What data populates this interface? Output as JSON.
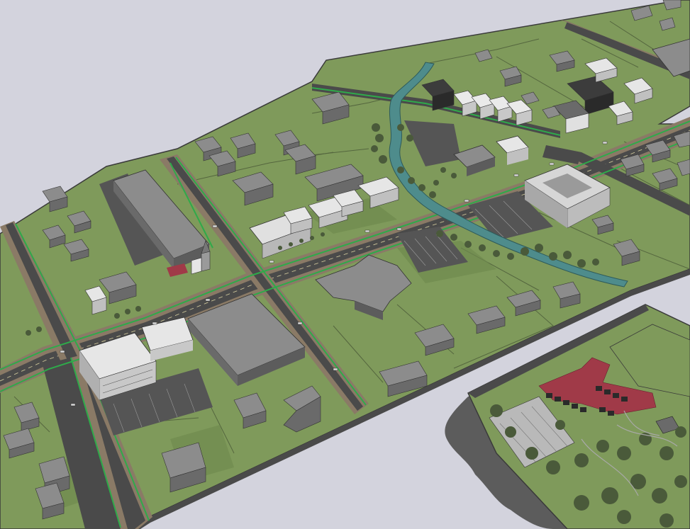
{
  "scene": {
    "kind": "3d-urban-model",
    "colors": {
      "sky": "#d3d3dd",
      "grass": "#7f9a5b",
      "grass_dark": "#6f8a4e",
      "road": "#4a4a4a",
      "sidewalk": "#8a7a66",
      "parking": "#555555",
      "building_gray": "#8c8c8c",
      "building_white": "#e6e6e6",
      "building_dark": "#3c3c3c",
      "roof_dark": "#6a6a6a",
      "water": "#4e8c8c",
      "bike_lane": "#2faa4a",
      "plaza_red": "#a03a48",
      "tree": "#4a5a3a",
      "shadow": "#5c5c5c"
    },
    "features": [
      "main-street",
      "cross-street-center",
      "cross-street-left",
      "creek",
      "bike-lanes",
      "big-box-stores",
      "mixed-use-rowhouses",
      "residential-houses",
      "park-with-plaza",
      "parking-lots"
    ]
  }
}
